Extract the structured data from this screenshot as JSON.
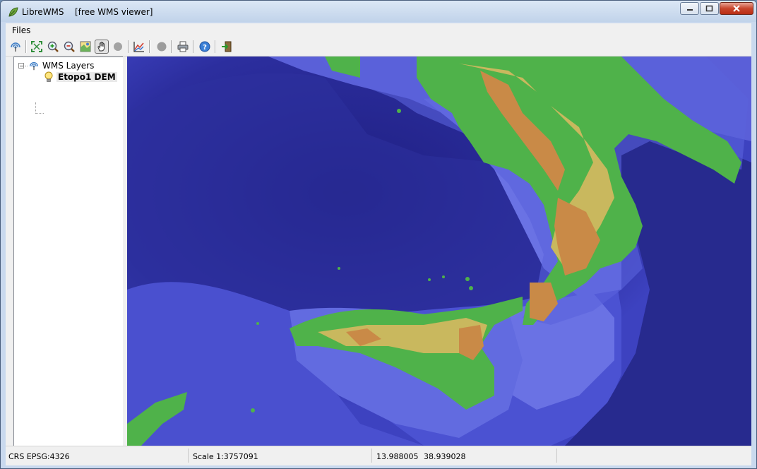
{
  "window": {
    "app_title": "LibreWMS",
    "subtitle": "[free WMS viewer]"
  },
  "menu": {
    "files_label": "Files"
  },
  "toolbar": {
    "buttons": [
      "wms-connect-icon",
      "zoom-extent-icon",
      "zoom-in-icon",
      "zoom-out-icon",
      "zoom-layer-icon",
      "pan-hand-icon",
      "disabled-circle-icon",
      "chart-profile-icon",
      "stop-icon",
      "print-icon",
      "help-icon",
      "exit-icon"
    ],
    "active": "pan-hand-icon"
  },
  "layers": {
    "root_label": "WMS Layers",
    "items": [
      {
        "label": "Etopo1 DEM"
      }
    ]
  },
  "status": {
    "crs": "CRS EPSG:4326",
    "scale": "Scale 1:3757091",
    "lon": "13.988005",
    "lat": "38.939028"
  },
  "colors": {
    "deep_sea": "#2a2a95",
    "shallow_sea": "#5a60d8",
    "lowland": "#4fb24a",
    "upland": "#c9b85e",
    "mountain": "#c98a47"
  }
}
